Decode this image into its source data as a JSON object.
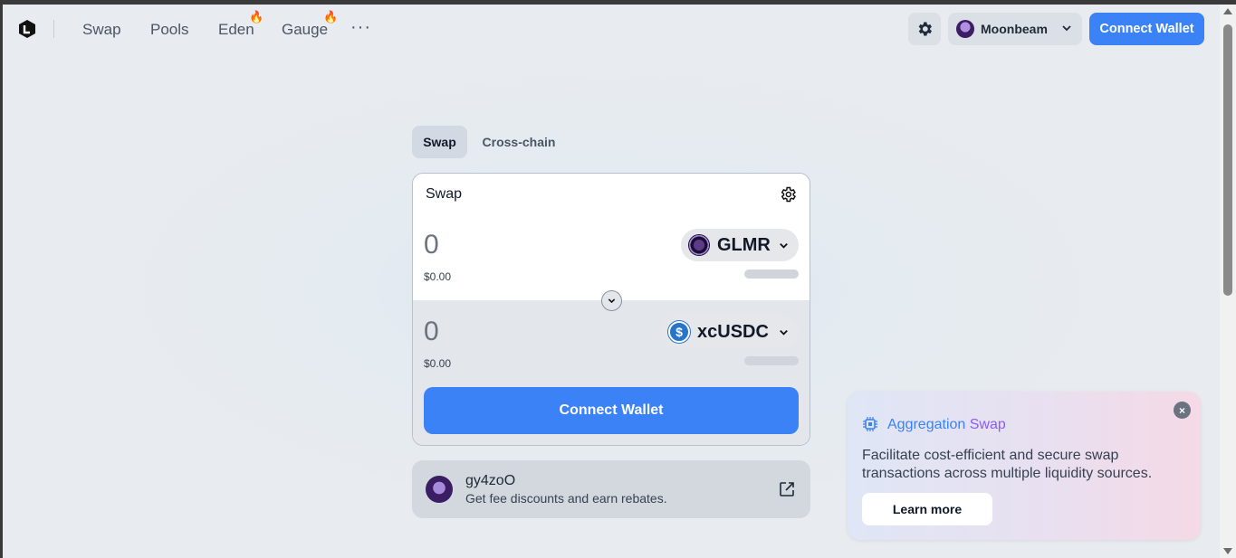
{
  "nav": {
    "links": [
      "Swap",
      "Pools",
      "Eden",
      "Gauge"
    ],
    "more": "···"
  },
  "network": {
    "label": "Moonbeam"
  },
  "connect_wallet_top": "Connect Wallet",
  "tabs": [
    "Swap",
    "Cross-chain"
  ],
  "swap_card": {
    "title": "Swap",
    "from": {
      "amount": "0",
      "usd": "$0.00",
      "token": "GLMR"
    },
    "to": {
      "amount": "0",
      "usd": "$0.00",
      "token": "xcUSDC"
    },
    "connect_button": "Connect Wallet"
  },
  "referral": {
    "name": "gy4zoO",
    "subtitle": "Get fee discounts and earn rebates."
  },
  "promo": {
    "title_part1": "Aggregation",
    "title_part2": " Swap",
    "description": "Facilitate cost-efficient and secure swap transactions across multiple liquidity sources.",
    "button": "Learn more",
    "close": "×"
  },
  "colors": {
    "accent": "#3b82f6",
    "accent_purple": "#8b5cf6",
    "fire": "#f97316"
  }
}
